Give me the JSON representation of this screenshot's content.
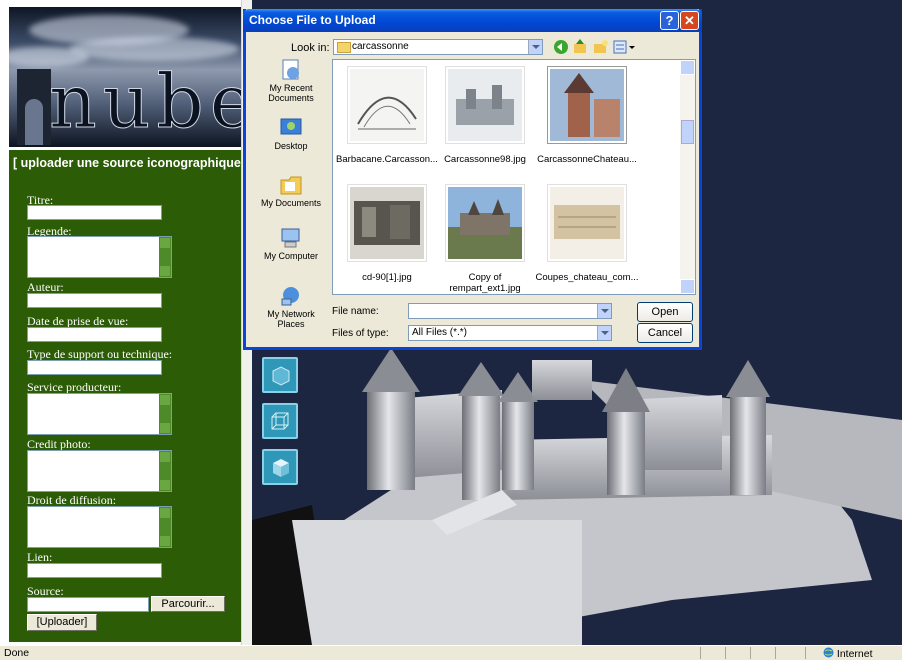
{
  "banner": {
    "logo_text": "nubes"
  },
  "form": {
    "title": "[ uploader une source iconographique ]",
    "fields": [
      {
        "label": "Titre:"
      },
      {
        "label": "Legende:"
      },
      {
        "label": "Auteur:"
      },
      {
        "label": "Date de prise de vue:"
      },
      {
        "label": "Type de support ou technique:"
      },
      {
        "label": "Service producteur:"
      },
      {
        "label": "Credit photo:"
      },
      {
        "label": "Droit de diffusion:"
      },
      {
        "label": "Lien:"
      },
      {
        "label": "Source:"
      }
    ],
    "browse_label": "Parcourir...",
    "upload_label": "[Uploader]"
  },
  "dialog": {
    "title": "Choose File to Upload",
    "look_in_label": "Look in:",
    "look_in_value": "carcassonne",
    "places": [
      "My Recent Documents",
      "Desktop",
      "My Documents",
      "My Computer",
      "My Network Places"
    ],
    "files": [
      "Barbacane.Carcasson...",
      "Carcassonne98.jpg",
      "CarcassonneChateau...",
      "cd-90[1].jpg",
      "Copy of rempart_ext1.jpg",
      "Coupes_chateau_com..."
    ],
    "file_name_label": "File name:",
    "file_name_value": "",
    "files_of_type_label": "Files of type:",
    "files_of_type_value": "All Files (*.*)",
    "open_label": "Open",
    "cancel_label": "Cancel",
    "title_help": "?",
    "title_close": "✕"
  },
  "status": {
    "text": "Done",
    "zone": "Internet"
  },
  "colors": {
    "form_bg": "#2c5c05",
    "viewer_bg": "#1d2640",
    "title_bar": "#0047d4"
  }
}
